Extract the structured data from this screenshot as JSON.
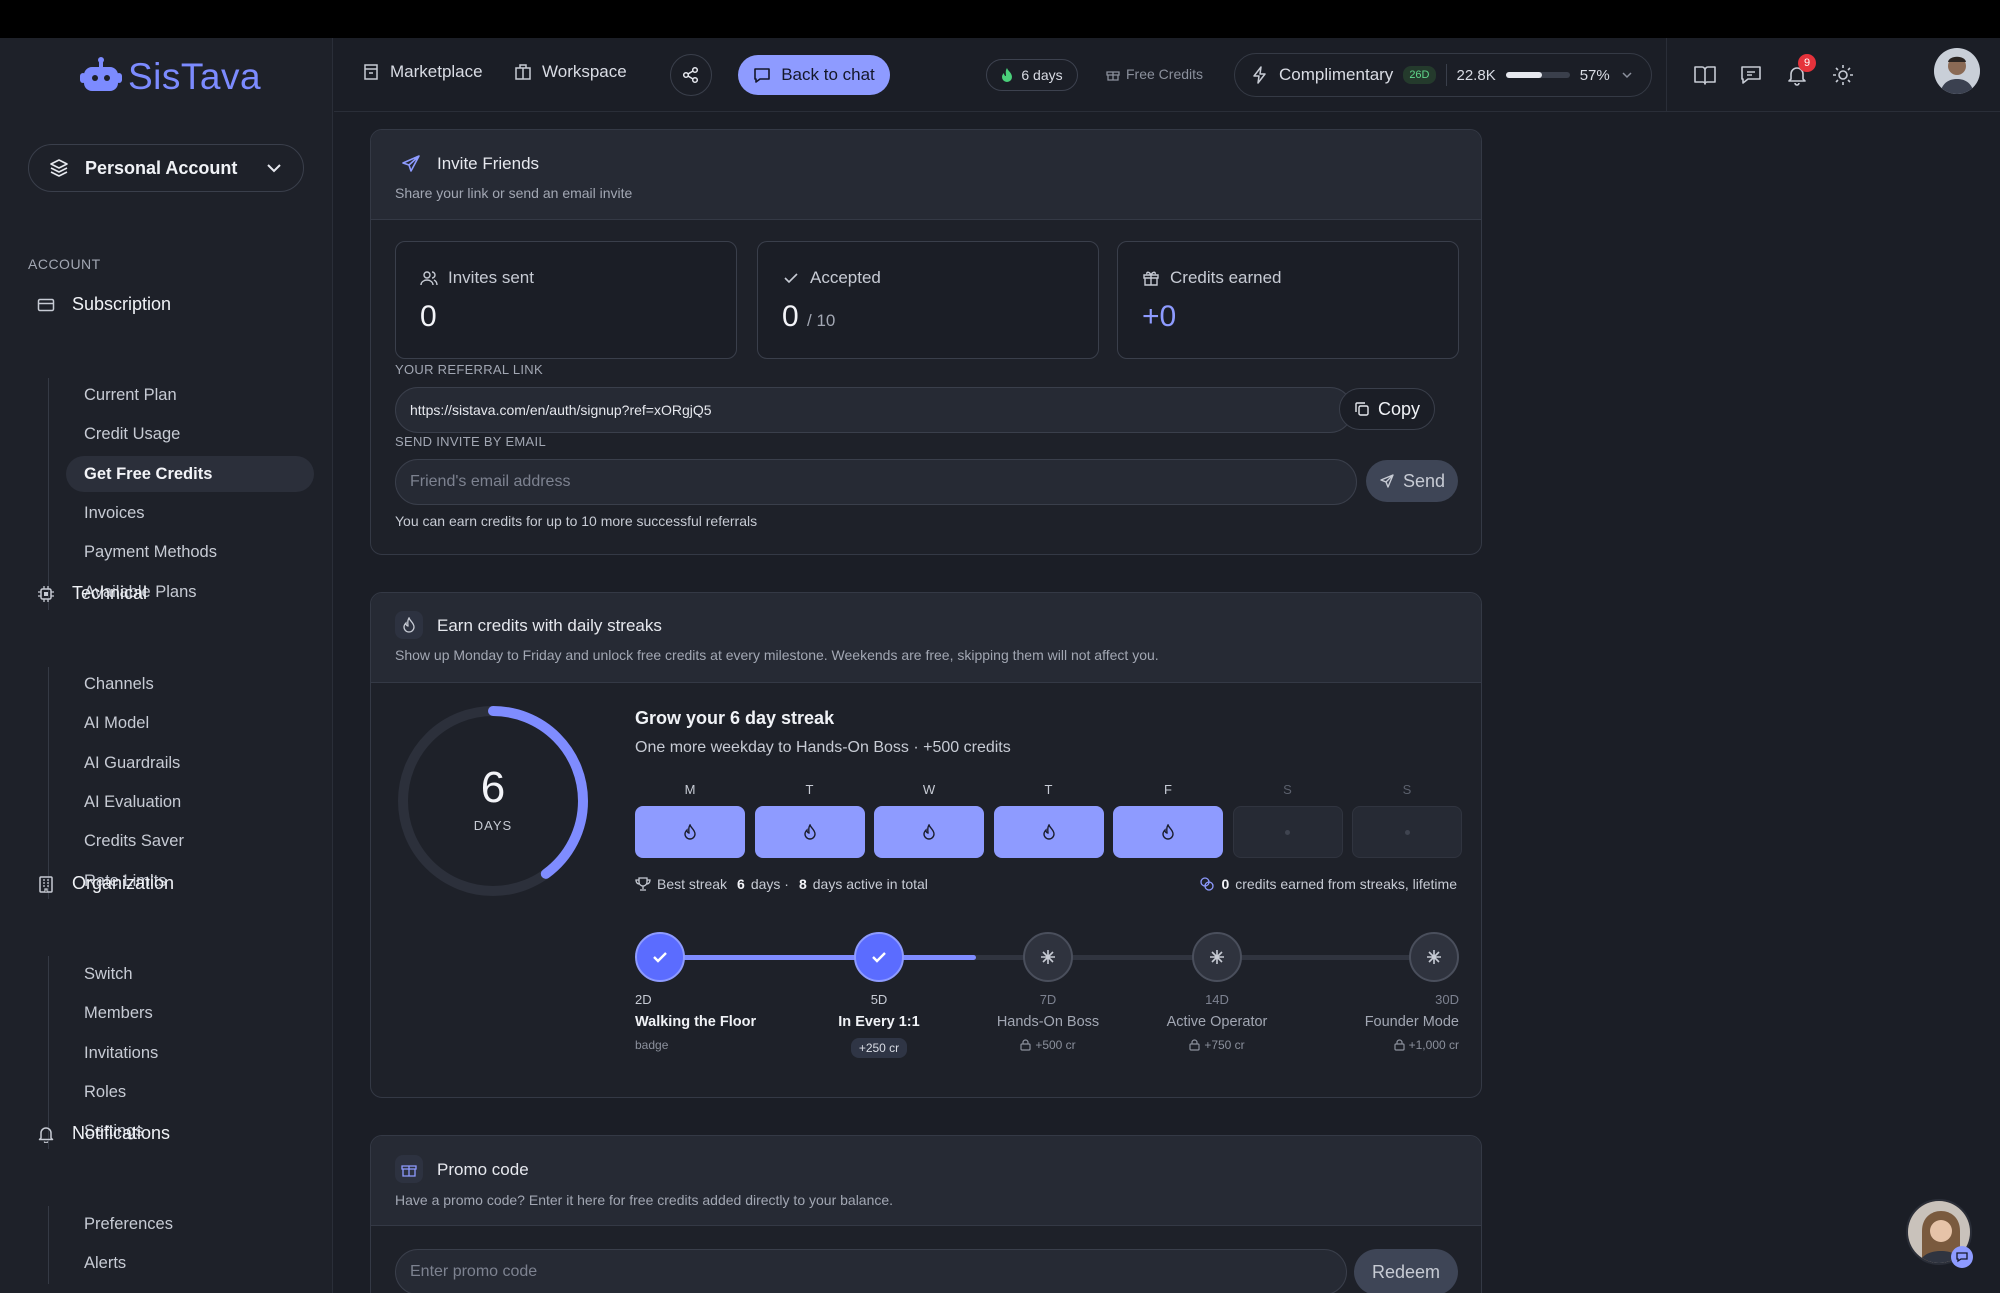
{
  "app": {
    "logo_text": "SisTava"
  },
  "sidebar": {
    "account_label": "Personal Account",
    "section_caption": "ACCOUNT",
    "groups": [
      {
        "label": "Subscription",
        "items": [
          "Current Plan",
          "Credit Usage",
          "Get Free Credits",
          "Invoices",
          "Payment Methods",
          "Available Plans"
        ]
      },
      {
        "label": "Technical",
        "items": [
          "Channels",
          "AI Model",
          "AI Guardrails",
          "AI Evaluation",
          "Credits Saver",
          "Rate Limits"
        ]
      },
      {
        "label": "Organization",
        "items": [
          "Switch",
          "Members",
          "Invitations",
          "Roles",
          "Settings"
        ]
      },
      {
        "label": "Notifications",
        "items": [
          "Preferences",
          "Alerts"
        ]
      }
    ],
    "active_item": "Get Free Credits"
  },
  "header": {
    "marketplace": "Marketplace",
    "workspace": "Workspace",
    "back_to_chat": "Back to chat",
    "streak_days": "6 days",
    "free_credits": "Free Credits",
    "plan_name": "Complimentary",
    "plan_badge": "26D",
    "credits_amount": "22.8K",
    "credits_percent": "57%",
    "credits_fraction": 0.57,
    "notification_count": "9"
  },
  "invite": {
    "title": "Invite Friends",
    "subtitle": "Share your link or send an email invite",
    "stats": {
      "sent_label": "Invites sent",
      "sent_value": "0",
      "accepted_label": "Accepted",
      "accepted_value": "0",
      "accepted_max": "/ 10",
      "earned_label": "Credits earned",
      "earned_value": "+0"
    },
    "referral_caption": "YOUR REFERRAL LINK",
    "referral_link": "https://sistava.com/en/auth/signup?ref=xORgjQ5",
    "copy_label": "Copy",
    "email_caption": "SEND INVITE BY EMAIL",
    "email_placeholder": "Friend's email address",
    "send_label": "Send",
    "note": "You can earn credits for up to 10 more successful referrals"
  },
  "streaks": {
    "title": "Earn credits with daily streaks",
    "subtitle": "Show up Monday to Friday and unlock free credits at every milestone. Weekends are free, skipping them will not affect you.",
    "ring_value": "6",
    "ring_label": "DAYS",
    "ring_progress": 0.4,
    "heading": "Grow your 6 day streak",
    "subheading": "One more weekday to Hands-On Boss · +500 credits",
    "days": [
      {
        "label": "M",
        "active": true
      },
      {
        "label": "T",
        "active": true
      },
      {
        "label": "W",
        "active": true
      },
      {
        "label": "T",
        "active": true
      },
      {
        "label": "F",
        "active": true
      },
      {
        "label": "S",
        "active": false
      },
      {
        "label": "S",
        "active": false
      }
    ],
    "best_streak_label": "Best streak",
    "best_streak_value": "6",
    "best_streak_unit": "days ·",
    "active_total_value": "8",
    "active_total_label": "days active in total",
    "lifetime_value": "0",
    "lifetime_label": "credits earned from streaks, lifetime",
    "track_progress": 0.4,
    "milestones": [
      {
        "day": "2D",
        "name": "Walking the Floor",
        "reward": "badge",
        "done": true
      },
      {
        "day": "5D",
        "name": "In Every 1:1",
        "reward": "+250 cr",
        "done": true
      },
      {
        "day": "7D",
        "name": "Hands-On Boss",
        "reward": "+500 cr",
        "done": false
      },
      {
        "day": "14D",
        "name": "Active Operator",
        "reward": "+750 cr",
        "done": false
      },
      {
        "day": "30D",
        "name": "Founder Mode",
        "reward": "+1,000 cr",
        "done": false
      }
    ]
  },
  "promo": {
    "title": "Promo code",
    "subtitle": "Have a promo code? Enter it here for free credits added directly to your balance.",
    "placeholder": "Enter promo code",
    "redeem_label": "Redeem"
  },
  "colors": {
    "accent": "#8e9bff",
    "background": "#1b1e26",
    "sidebar": "#1e2129",
    "badge": "#e5323b"
  },
  "icons": [
    "layers-icon",
    "credit-card-icon",
    "cpu-icon",
    "building-icon",
    "bell-icon",
    "store-icon",
    "briefcase-icon",
    "share-icon",
    "chat-icon",
    "flame-icon",
    "gift-icon",
    "bolt-icon",
    "book-icon",
    "message-icon",
    "sun-icon",
    "send-icon",
    "users-icon",
    "check-icon",
    "copy-icon",
    "trophy-icon",
    "coins-icon",
    "lock-icon",
    "star-icon"
  ]
}
